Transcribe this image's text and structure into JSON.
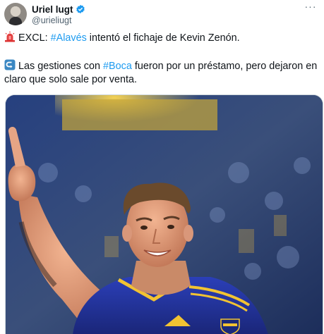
{
  "author": {
    "display_name": "Uriel lugt",
    "handle": "@urieliugt",
    "verified_icon": "verified-badge-icon",
    "accent": "#1d9bf0"
  },
  "menu": {
    "icon": "more-options-icon",
    "glyph": "···"
  },
  "tweet": {
    "line1": {
      "emoji": "siren-emoji",
      "prefix": "EXCL: ",
      "hashtag": "#Alavés",
      "suffix": " intentó el fichaje de Kevin Zenón."
    },
    "line2": {
      "emoji": "return-arrow-emoji",
      "prefix": "Las gestiones con ",
      "hashtag": "#Boca",
      "suffix": " fueron por un préstamo, pero dejaron en claro que solo sale por venta."
    }
  },
  "media": {
    "type": "photo",
    "icon": "player-photo"
  }
}
